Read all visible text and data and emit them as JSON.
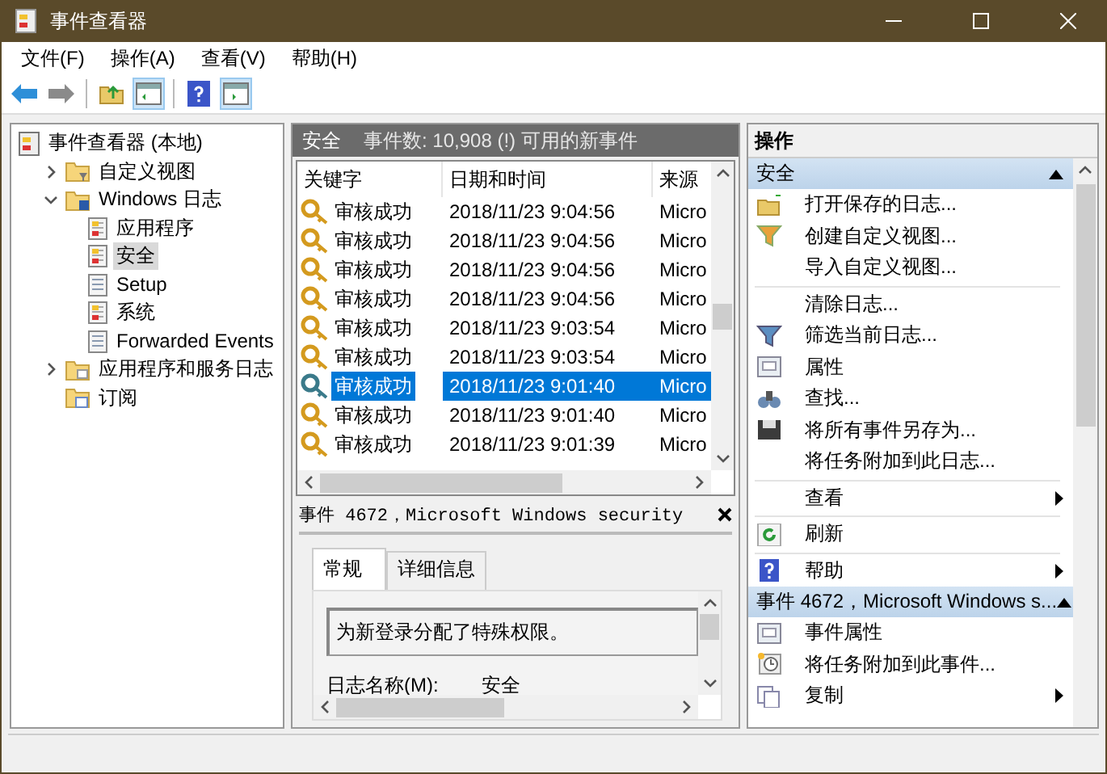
{
  "window": {
    "title": "事件查看器"
  },
  "menu": [
    "文件(F)",
    "操作(A)",
    "查看(V)",
    "帮助(H)"
  ],
  "tree": [
    {
      "label": "事件查看器 (本地)",
      "kind": "console",
      "selected": false,
      "children": [
        {
          "label": "自定义视图",
          "kind": "folder-filter",
          "expanded": false,
          "selected": false
        },
        {
          "label": "Windows 日志",
          "kind": "folder-logs",
          "expanded": true,
          "selected": false,
          "children": [
            {
              "label": "应用程序",
              "kind": "log-alert",
              "selected": false
            },
            {
              "label": "安全",
              "kind": "log-alert",
              "selected": true
            },
            {
              "label": "Setup",
              "kind": "log",
              "selected": false
            },
            {
              "label": "系统",
              "kind": "log-alert",
              "selected": false
            },
            {
              "label": "Forwarded Events",
              "kind": "log",
              "selected": false
            }
          ]
        },
        {
          "label": "应用程序和服务日志",
          "kind": "folder",
          "expanded": false,
          "selected": false
        },
        {
          "label": "订阅",
          "kind": "subscription",
          "selected": false
        }
      ]
    }
  ],
  "events": {
    "title": "安全",
    "summary": "事件数: 10,908 (!) 可用的新事件",
    "columns": [
      "关键字",
      "日期和时间",
      "来源"
    ],
    "rows": [
      {
        "keyword": "审核成功",
        "datetime": "2018/11/23 9:04:56",
        "source": "Micro",
        "selected": false
      },
      {
        "keyword": "审核成功",
        "datetime": "2018/11/23 9:04:56",
        "source": "Micro",
        "selected": false
      },
      {
        "keyword": "审核成功",
        "datetime": "2018/11/23 9:04:56",
        "source": "Micro",
        "selected": false
      },
      {
        "keyword": "审核成功",
        "datetime": "2018/11/23 9:04:56",
        "source": "Micro",
        "selected": false
      },
      {
        "keyword": "审核成功",
        "datetime": "2018/11/23 9:03:54",
        "source": "Micro",
        "selected": false
      },
      {
        "keyword": "审核成功",
        "datetime": "2018/11/23 9:03:54",
        "source": "Micro",
        "selected": false
      },
      {
        "keyword": "审核成功",
        "datetime": "2018/11/23 9:01:40",
        "source": "Micro",
        "selected": true
      },
      {
        "keyword": "审核成功",
        "datetime": "2018/11/23 9:01:40",
        "source": "Micro",
        "selected": false
      },
      {
        "keyword": "审核成功",
        "datetime": "2018/11/23 9:01:39",
        "source": "Micro",
        "selected": false
      }
    ]
  },
  "detail": {
    "title": "事件 4672，Microsoft Windows security",
    "tabs": [
      {
        "label": "常规",
        "selected": true
      },
      {
        "label": "详细信息",
        "selected": false
      }
    ],
    "description": "为新登录分配了特殊权限。",
    "fields": [
      {
        "label": "日志名称(M):",
        "value": "安全"
      }
    ]
  },
  "actions": {
    "title": "操作",
    "sections": [
      {
        "title": "安全",
        "expanded": true,
        "groups": [
          [
            {
              "label": "打开保存的日志...",
              "kind": "open",
              "submenu": false
            },
            {
              "label": "创建自定义视图...",
              "kind": "filter-create",
              "submenu": false
            },
            {
              "label": "导入自定义视图...",
              "kind": "text",
              "submenu": false
            }
          ],
          [
            {
              "label": "清除日志...",
              "kind": "text",
              "submenu": false
            },
            {
              "label": "筛选当前日志...",
              "kind": "filter",
              "submenu": false
            },
            {
              "label": "属性",
              "kind": "properties",
              "submenu": false
            },
            {
              "label": "查找...",
              "kind": "find",
              "submenu": false
            },
            {
              "label": "将所有事件另存为...",
              "kind": "save",
              "submenu": false
            },
            {
              "label": "将任务附加到此日志...",
              "kind": "text",
              "submenu": false
            }
          ],
          [
            {
              "label": "查看",
              "kind": "text",
              "submenu": true
            }
          ],
          [
            {
              "label": "刷新",
              "kind": "refresh",
              "submenu": false
            }
          ],
          [
            {
              "label": "帮助",
              "kind": "help",
              "submenu": true
            }
          ]
        ]
      },
      {
        "title": "事件 4672，Microsoft Windows s...",
        "expanded": true,
        "groups": [
          [
            {
              "label": "事件属性",
              "kind": "properties",
              "submenu": false
            },
            {
              "label": "将任务附加到此事件...",
              "kind": "task",
              "submenu": false
            },
            {
              "label": "复制",
              "kind": "copy",
              "submenu": true
            }
          ]
        ]
      }
    ]
  }
}
